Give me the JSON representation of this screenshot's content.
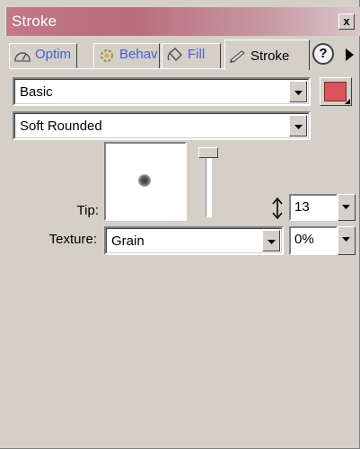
{
  "window": {
    "title": "Stroke",
    "close_label": "x"
  },
  "tabs": [
    {
      "label": "Optim",
      "icon": "optimize-icon",
      "active": false
    },
    {
      "label": "Behav",
      "icon": "behavior-gear-icon",
      "active": false
    },
    {
      "label": "Fill",
      "icon": "fill-bucket-icon",
      "active": false
    },
    {
      "label": "Stroke",
      "icon": "pencil-icon",
      "active": true
    }
  ],
  "help_label": "?",
  "stroke": {
    "category": "Basic",
    "type": "Soft Rounded",
    "color": "#d9545c",
    "tip_label": "Tip:",
    "tip_size": "13",
    "texture_label": "Texture:",
    "texture": "Grain",
    "texture_amount": "0%"
  },
  "colors": {
    "panel": "#d4d0c8",
    "title_gradient_start": "#c27886",
    "inactive_tab_text": "#4a5ec8"
  }
}
